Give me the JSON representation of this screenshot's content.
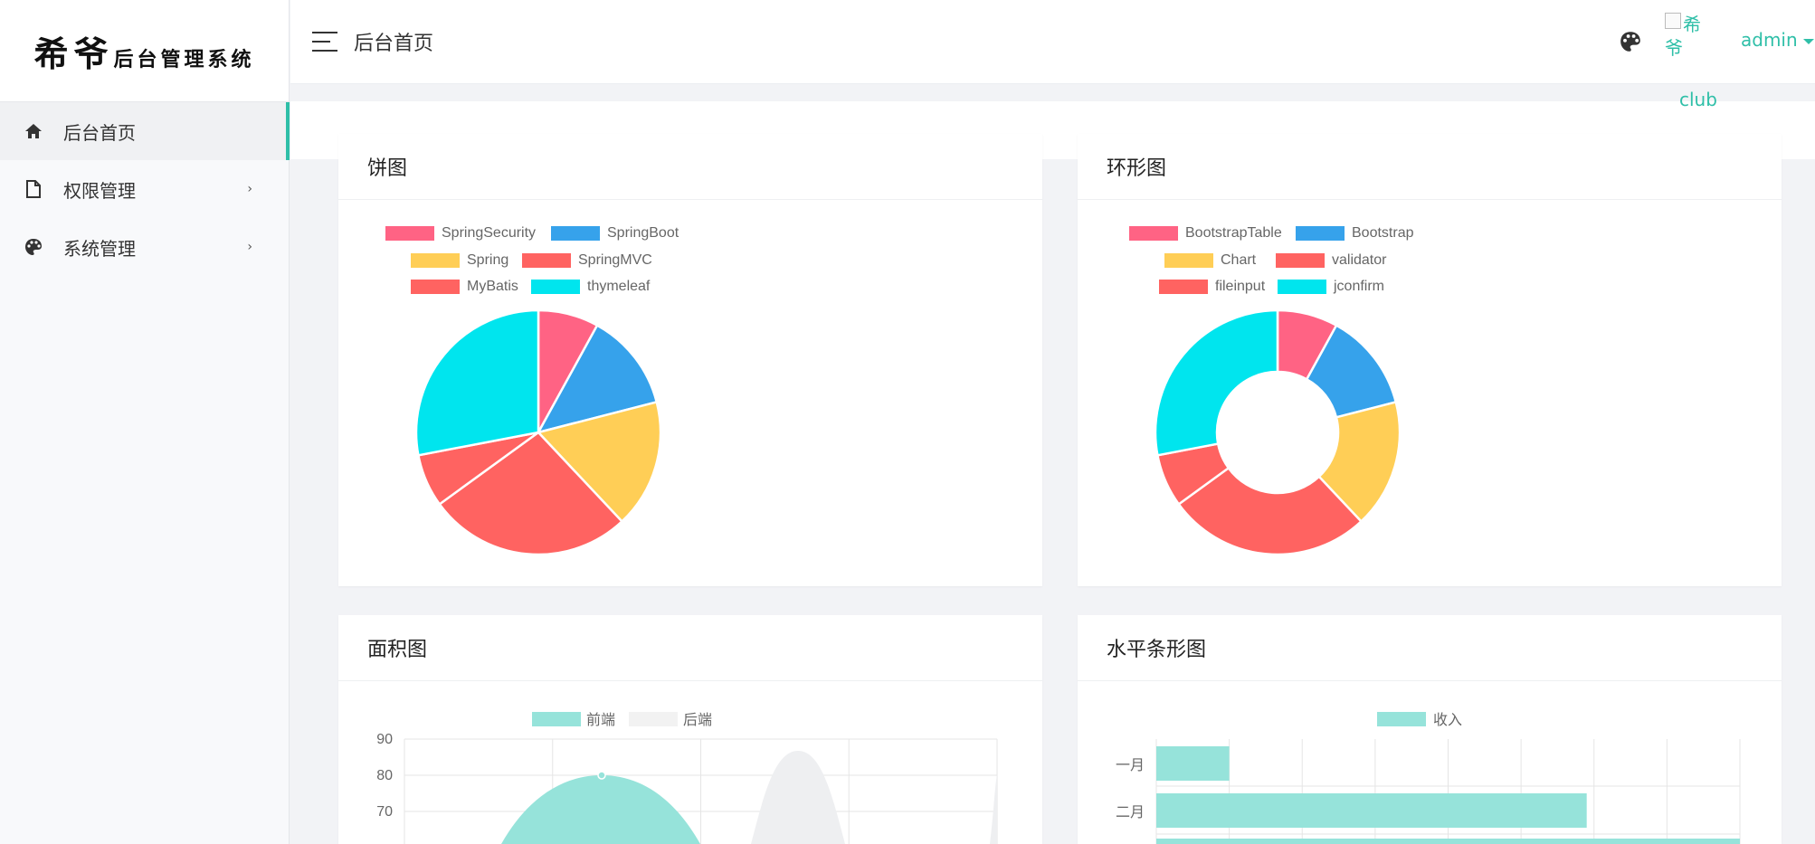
{
  "app": {
    "logo_big": "希爷",
    "logo_small": "后台管理系统"
  },
  "sidebar": {
    "items": [
      {
        "label": "后台首页",
        "icon": "home-icon",
        "active": true
      },
      {
        "label": "权限管理",
        "icon": "file-icon",
        "arrow": "›"
      },
      {
        "label": "系统管理",
        "icon": "palette-icon",
        "arrow": "›"
      }
    ]
  },
  "header": {
    "title": "后台首页",
    "avatar_alt": "希爷",
    "avatar_alt2": "club",
    "user": "admin"
  },
  "colors": {
    "accent": "#2fbfa8",
    "pink": "#ff6384",
    "blue": "#36a2eb",
    "yellow": "#ffce56",
    "red": "#ff6361",
    "cyan": "#00e5ee",
    "teal": "#96e3da"
  },
  "chart_data": [
    {
      "type": "pie",
      "title": "饼图",
      "labels": [
        "SpringSecurity",
        "SpringBoot",
        "Spring",
        "SpringMVC",
        "MyBatis",
        "thymeleaf"
      ],
      "values": [
        8,
        13,
        17,
        27,
        7,
        28
      ]
    },
    {
      "type": "pie",
      "variant": "doughnut",
      "title": "环形图",
      "labels": [
        "BootstrapTable",
        "Bootstrap",
        "Chart",
        "validator",
        "fileinput",
        "jconfirm"
      ],
      "values": [
        8,
        13,
        17,
        27,
        7,
        28
      ]
    },
    {
      "type": "area",
      "title": "面积图",
      "series": [
        {
          "name": "前端",
          "x": [
            0,
            1,
            2
          ],
          "y": [
            null,
            80,
            null
          ]
        },
        {
          "name": "后端"
        }
      ],
      "y_ticks": [
        90,
        80,
        70
      ]
    },
    {
      "type": "bar",
      "orientation": "horizontal",
      "title": "水平条形图",
      "categories": [
        "一月",
        "二月"
      ],
      "series": [
        {
          "name": "收入",
          "values": [
            10,
            59
          ]
        }
      ]
    }
  ]
}
